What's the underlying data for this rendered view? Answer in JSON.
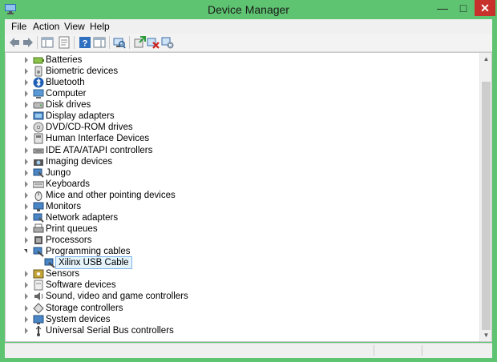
{
  "window": {
    "title": "Device Manager",
    "controls": [
      "—",
      "□",
      "✕"
    ]
  },
  "menu": [
    "File",
    "Action",
    "View",
    "Help"
  ],
  "toolbar": [
    "back-icon",
    "forward-icon",
    "show-hide-console-tree-icon",
    "properties-icon",
    "help-icon",
    "show-hide-action-pane-icon",
    "scan-hardware-icon",
    "update-driver-icon",
    "uninstall-icon",
    "disable-icon"
  ],
  "tree": [
    {
      "label": "Batteries",
      "icon": "battery"
    },
    {
      "label": "Biometric devices",
      "icon": "biometric"
    },
    {
      "label": "Bluetooth",
      "icon": "bluetooth"
    },
    {
      "label": "Computer",
      "icon": "computer"
    },
    {
      "label": "Disk drives",
      "icon": "disk"
    },
    {
      "label": "Display adapters",
      "icon": "display"
    },
    {
      "label": "DVD/CD-ROM drives",
      "icon": "dvd"
    },
    {
      "label": "Human Interface Devices",
      "icon": "hid"
    },
    {
      "label": "IDE ATA/ATAPI controllers",
      "icon": "ide"
    },
    {
      "label": "Imaging devices",
      "icon": "camera"
    },
    {
      "label": "Jungo",
      "icon": "usb"
    },
    {
      "label": "Keyboards",
      "icon": "keyboard"
    },
    {
      "label": "Mice and other pointing devices",
      "icon": "mouse"
    },
    {
      "label": "Monitors",
      "icon": "monitor"
    },
    {
      "label": "Network adapters",
      "icon": "network"
    },
    {
      "label": "Print queues",
      "icon": "printer"
    },
    {
      "label": "Processors",
      "icon": "cpu"
    },
    {
      "label": "Programming cables",
      "icon": "cable",
      "expanded": true
    },
    {
      "label": "Xilinx USB Cable",
      "icon": "cable",
      "child": true,
      "selected": true
    },
    {
      "label": "Sensors",
      "icon": "sensor"
    },
    {
      "label": "Software devices",
      "icon": "software"
    },
    {
      "label": "Sound, video and game controllers",
      "icon": "sound"
    },
    {
      "label": "Storage controllers",
      "icon": "storage"
    },
    {
      "label": "System devices",
      "icon": "system"
    },
    {
      "label": "Universal Serial Bus controllers",
      "icon": "usb-controller"
    }
  ]
}
